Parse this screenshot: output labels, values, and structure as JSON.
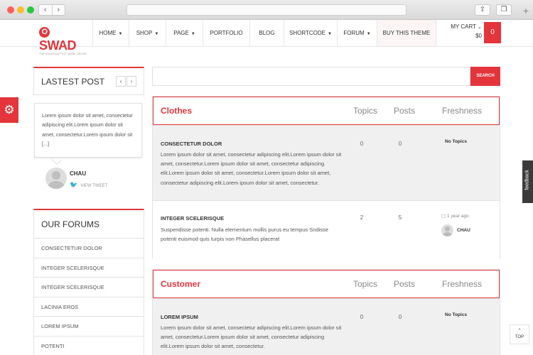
{
  "header": {
    "logo_text": "SWAD",
    "logo_letter": "O",
    "logo_tagline": "THE HANDCRAFTED THEME ONLINE",
    "menu": [
      {
        "label": "HOME",
        "caret": true
      },
      {
        "label": "SHOP",
        "caret": true
      },
      {
        "label": "PAGE",
        "caret": true
      },
      {
        "label": "PORTFOLIO",
        "caret": false
      },
      {
        "label": "BLOG",
        "caret": false
      },
      {
        "label": "SHORTCODE",
        "caret": true
      },
      {
        "label": "FORUM",
        "caret": true
      },
      {
        "label": "BUY THIS THEME",
        "caret": false
      }
    ],
    "cart_label": "MY CART",
    "cart_total": "$0",
    "cart_count": "0"
  },
  "sidebar": {
    "latest_title": "LASTEST POST",
    "prev": "‹",
    "next": "›",
    "latest_text": "Lorem ipsum dolor sit amet, consectetur adipiscing elit.Lorem ipsum dolor sit amet, consectetur.Lorem ipsum dolor sit [...]",
    "author": "CHAU",
    "tweet_label": "VIEW TWEET",
    "forums_title": "OUR FORUMS",
    "forums": [
      "CONSECTETUR DOLOR",
      "INTEGER SCELERISQUE",
      "INTEGER SCELERISQUE",
      "LACINIA EROS",
      "LOREM IPSUM",
      "POTENTI"
    ]
  },
  "search": {
    "placeholder": "",
    "button": "SEARCH"
  },
  "columns": {
    "topics": "Topics",
    "posts": "Posts",
    "freshness": "Freshness"
  },
  "groups": [
    {
      "title": "Clothes",
      "rows": [
        {
          "title": "CONSECTETUR DOLOR",
          "desc": "Lorem ipsum dolor sit amet, consectetur adipiscing elit.Lorem ipsum dolor sit amet, consectetur.Lorem ipsum dolor sit amet, consectetur adipiscing elit.Lorem ipsum dolor sit amet, consectetur.Lorem ipsum dolor sit amet, consectetur adipiscing elit.Lorem ipsum dolor sit amet, consectetur.",
          "topics": "0",
          "posts": "0",
          "freshness": "No Topics"
        },
        {
          "title": "INTEGER SCELERISQUE",
          "desc": "Suspendisse potenti. Nulla elementum mollis purus eu tempus Sndisse potenti euismod quis turpis non Phasellus placerat",
          "topics": "2",
          "posts": "5",
          "fresh_date": "1 year ago",
          "fresh_author": "CHAU"
        }
      ]
    },
    {
      "title": "Customer",
      "rows": [
        {
          "title": "LOREM IPSUM",
          "desc": "Lorem ipsum dolor sit amet, consectetur adipiscing elit.Lorem ipsum dolor sit amet, consectetur.Lorem ipsum dolor sit amet, consectetur adipiscing elit.Lorem ipsum dolor sit amet, consectetur.",
          "topics": "0",
          "posts": "0",
          "freshness": "No Topics"
        }
      ]
    }
  ],
  "feedback_label": "feedback",
  "top_arrow": "⌃",
  "top_label": "TOP",
  "icons": {
    "gear": "gear-icon",
    "twitter": "twitter-icon",
    "clock": "clock-icon"
  },
  "colors": {
    "accent": "#e3353b"
  }
}
